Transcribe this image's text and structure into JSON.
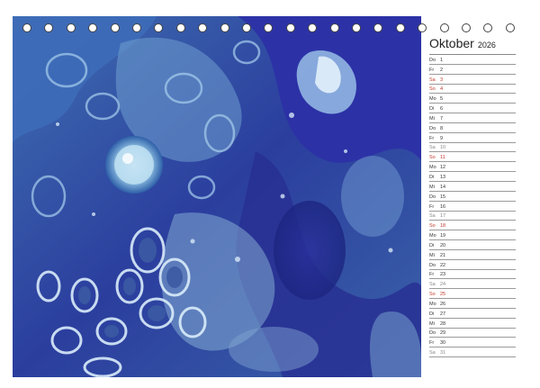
{
  "calendar": {
    "month": "Oktober",
    "year": "2026",
    "days": [
      {
        "wd": "Do",
        "n": "1",
        "kind": "weekday"
      },
      {
        "wd": "Fr",
        "n": "2",
        "kind": "weekday"
      },
      {
        "wd": "Sa",
        "n": "3",
        "kind": "sun"
      },
      {
        "wd": "So",
        "n": "4",
        "kind": "sun"
      },
      {
        "wd": "Mo",
        "n": "5",
        "kind": "weekday"
      },
      {
        "wd": "Di",
        "n": "6",
        "kind": "weekday"
      },
      {
        "wd": "Mi",
        "n": "7",
        "kind": "weekday"
      },
      {
        "wd": "Do",
        "n": "8",
        "kind": "weekday"
      },
      {
        "wd": "Fr",
        "n": "9",
        "kind": "weekday"
      },
      {
        "wd": "Sa",
        "n": "10",
        "kind": "sat"
      },
      {
        "wd": "So",
        "n": "11",
        "kind": "sun"
      },
      {
        "wd": "Mo",
        "n": "12",
        "kind": "weekday"
      },
      {
        "wd": "Di",
        "n": "13",
        "kind": "weekday"
      },
      {
        "wd": "Mi",
        "n": "14",
        "kind": "weekday"
      },
      {
        "wd": "Do",
        "n": "15",
        "kind": "weekday"
      },
      {
        "wd": "Fr",
        "n": "16",
        "kind": "weekday"
      },
      {
        "wd": "Sa",
        "n": "17",
        "kind": "sat"
      },
      {
        "wd": "So",
        "n": "18",
        "kind": "sun"
      },
      {
        "wd": "Mo",
        "n": "19",
        "kind": "weekday"
      },
      {
        "wd": "Di",
        "n": "20",
        "kind": "weekday"
      },
      {
        "wd": "Mi",
        "n": "21",
        "kind": "weekday"
      },
      {
        "wd": "Do",
        "n": "22",
        "kind": "weekday"
      },
      {
        "wd": "Fr",
        "n": "23",
        "kind": "weekday"
      },
      {
        "wd": "Sa",
        "n": "24",
        "kind": "sat"
      },
      {
        "wd": "So",
        "n": "25",
        "kind": "sun"
      },
      {
        "wd": "Mo",
        "n": "26",
        "kind": "weekday"
      },
      {
        "wd": "Di",
        "n": "27",
        "kind": "weekday"
      },
      {
        "wd": "Mi",
        "n": "28",
        "kind": "weekday"
      },
      {
        "wd": "Do",
        "n": "29",
        "kind": "weekday"
      },
      {
        "wd": "Fr",
        "n": "30",
        "kind": "weekday"
      },
      {
        "wd": "Sa",
        "n": "31",
        "kind": "sat"
      }
    ]
  },
  "colors": {
    "weekend_sunday": "#c0392b",
    "weekend_saturday": "#888888",
    "art_deep": "#2a3a9a",
    "art_light": "#cfe4f4"
  }
}
